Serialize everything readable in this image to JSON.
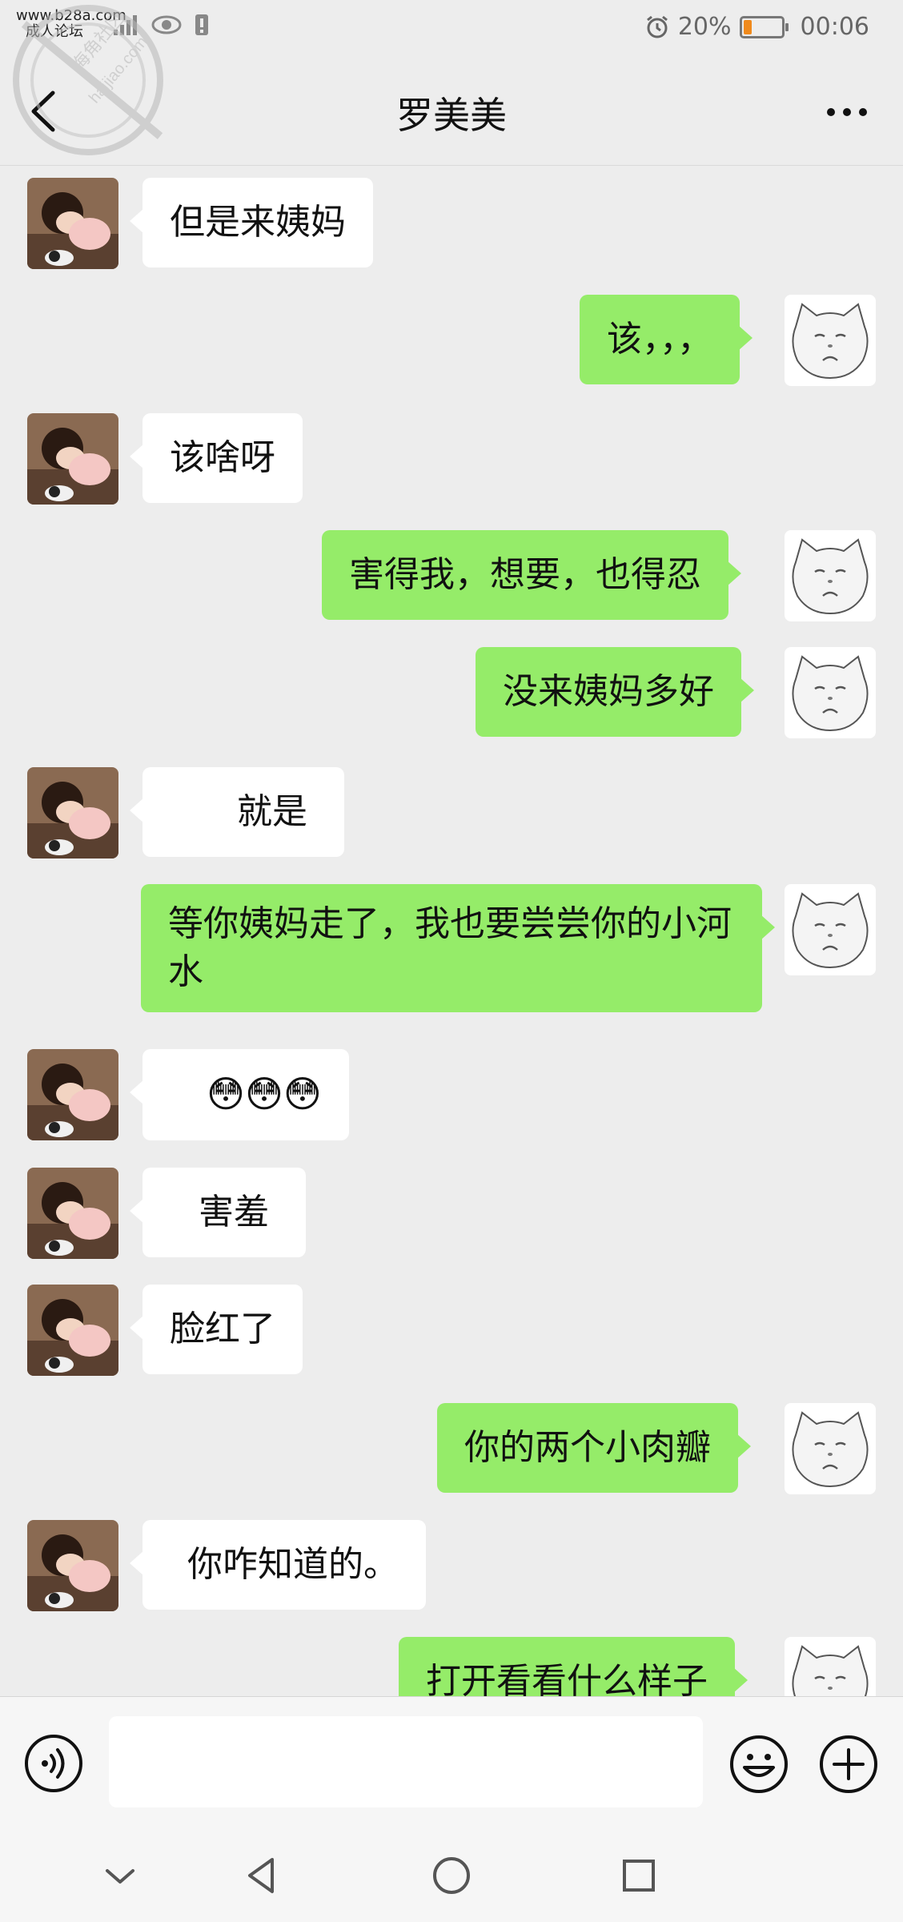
{
  "status_bar": {
    "site": "www.b28a.com",
    "site2": "成人论坛",
    "battery_percent": "20%",
    "battery_level": 0.2,
    "time": "00:06"
  },
  "header": {
    "title": "罗美美",
    "back_icon": "chevron-left-icon",
    "more_icon": "more-dots-icon"
  },
  "watermark": {
    "line1": "海角社区",
    "line2": "haijiao.com"
  },
  "messages": [
    {
      "side": "in",
      "text": "但是来姨妈"
    },
    {
      "side": "out",
      "text": "该，，，"
    },
    {
      "side": "in",
      "text": "该啥呀"
    },
    {
      "side": "out",
      "text": "害得我，想要，也得忍"
    },
    {
      "side": "out",
      "text": "没来姨妈多好"
    },
    {
      "side": "in",
      "text": "就是"
    },
    {
      "side": "out",
      "text": "等你姨妈走了，我也要尝尝你的小河水"
    },
    {
      "side": "in",
      "text": "😳😳😳"
    },
    {
      "side": "in",
      "text": "害羞"
    },
    {
      "side": "in",
      "text": "脸红了"
    },
    {
      "side": "out",
      "text": "你的两个小肉瓣"
    },
    {
      "side": "in",
      "text": "你咋知道的。"
    },
    {
      "side": "out",
      "text": "打开看看什么样子"
    }
  ],
  "input_bar": {
    "voice_icon": "voice-icon",
    "emoji_icon": "emoji-icon",
    "plus_icon": "plus-icon",
    "text_value": ""
  },
  "nav_bar": {
    "icons": [
      "collapse-icon",
      "back-triangle-icon",
      "home-circle-icon",
      "recents-square-icon"
    ]
  },
  "colors": {
    "background": "#ededed",
    "incoming_bubble": "#ffffff",
    "outgoing_bubble": "#95ec69",
    "battery_fill": "#f08a1c"
  }
}
